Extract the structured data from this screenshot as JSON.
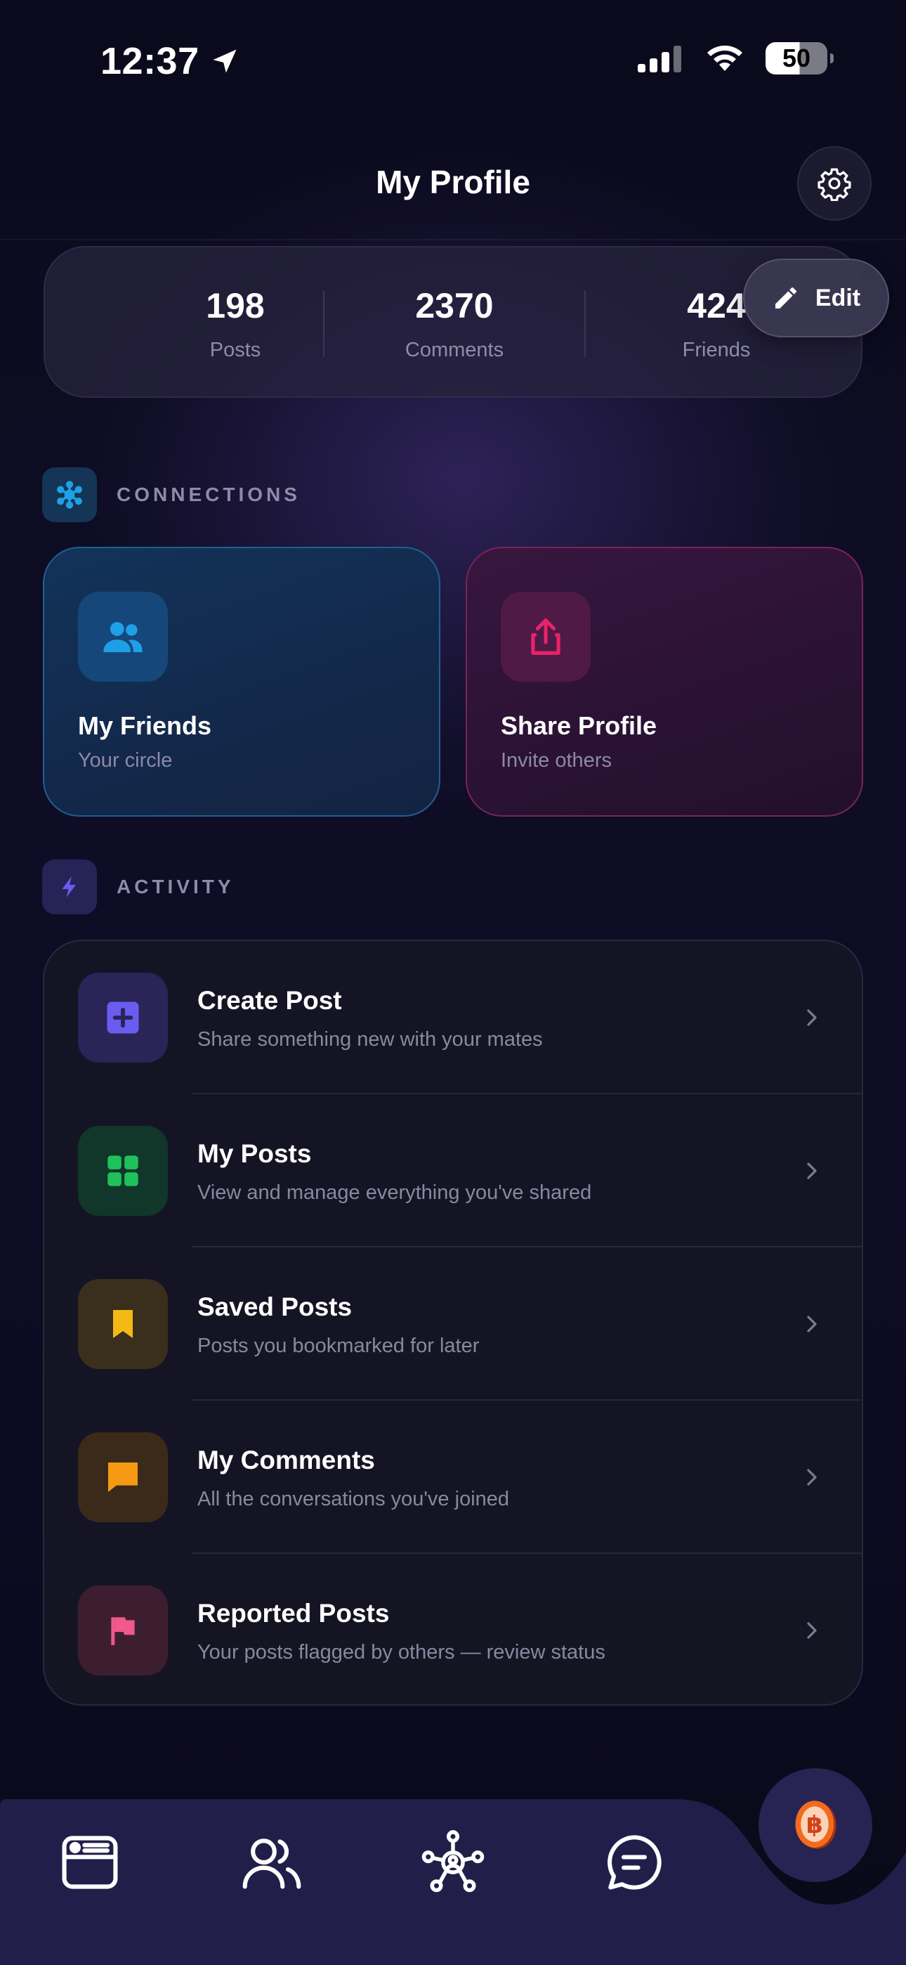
{
  "status_bar": {
    "time": "12:37",
    "battery": "50"
  },
  "header": {
    "title": "My Profile"
  },
  "stats": [
    {
      "value": "198",
      "label": "Posts"
    },
    {
      "value": "2370",
      "label": "Comments"
    },
    {
      "value": "424",
      "label": "Friends"
    }
  ],
  "edit_label": "Edit",
  "connections": {
    "title": "CONNECTIONS",
    "cards": [
      {
        "title": "My Friends",
        "subtitle": "Your circle",
        "icon": "people-icon",
        "color": "#1ea0e6"
      },
      {
        "title": "Share Profile",
        "subtitle": "Invite others",
        "icon": "share-icon",
        "color": "#e8226c"
      }
    ]
  },
  "activity": {
    "title": "ACTIVITY",
    "items": [
      {
        "title": "Create Post",
        "subtitle": "Share something new with your mates",
        "icon": "plus-square-icon",
        "color": "#6b5cf0"
      },
      {
        "title": "My Posts",
        "subtitle": "View and manage everything you've shared",
        "icon": "grid-icon",
        "color": "#1fc25a"
      },
      {
        "title": "Saved Posts",
        "subtitle": "Posts you bookmarked for later",
        "icon": "bookmark-icon",
        "color": "#f5b915"
      },
      {
        "title": "My Comments",
        "subtitle": "All the conversations you've joined",
        "icon": "comment-icon",
        "color": "#f59a12"
      },
      {
        "title": "Reported Posts",
        "subtitle": "Your posts flagged by others — review status",
        "icon": "flag-icon",
        "color": "#f0598a"
      }
    ]
  },
  "bottom_nav": [
    {
      "name": "feed",
      "icon": "feed-icon"
    },
    {
      "name": "friends",
      "icon": "people-icon"
    },
    {
      "name": "network",
      "icon": "network-icon"
    },
    {
      "name": "chat",
      "icon": "chat-icon"
    }
  ],
  "fab": {
    "icon": "coin-icon"
  }
}
